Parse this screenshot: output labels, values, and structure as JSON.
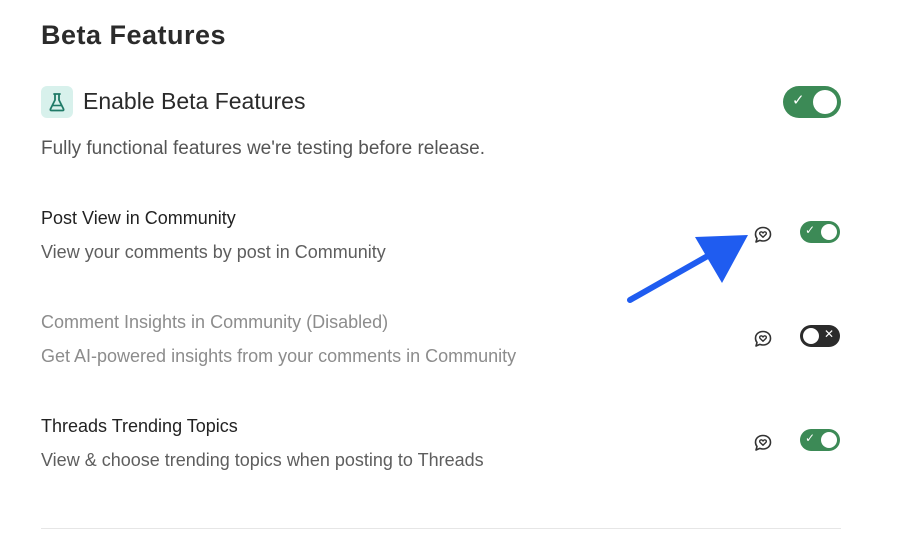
{
  "header": {
    "title": "Beta Features"
  },
  "beta": {
    "label": "Enable Beta Features",
    "description": "Fully functional features we're testing before release.",
    "enabled": true,
    "icon": "flask-icon"
  },
  "features": [
    {
      "title": "Post View in Community",
      "description": "View your comments by post in Community",
      "enabled": true,
      "disabled": false,
      "icon": "chat-heart-icon"
    },
    {
      "title": "Comment Insights in Community (Disabled)",
      "description": "Get AI-powered insights from your comments in Community",
      "enabled": false,
      "disabled": true,
      "icon": "chat-heart-icon"
    },
    {
      "title": "Threads Trending Topics",
      "description": "View & choose trending topics when posting to Threads",
      "enabled": true,
      "disabled": false,
      "icon": "chat-heart-icon"
    }
  ],
  "colors": {
    "toggle_on": "#3c8a56",
    "toggle_off": "#2b2b2b",
    "flask_bg": "#d8f1ec",
    "annotation_arrow": "#1f5cf0"
  },
  "glyphs": {
    "check": "✓",
    "cross": "✕"
  }
}
